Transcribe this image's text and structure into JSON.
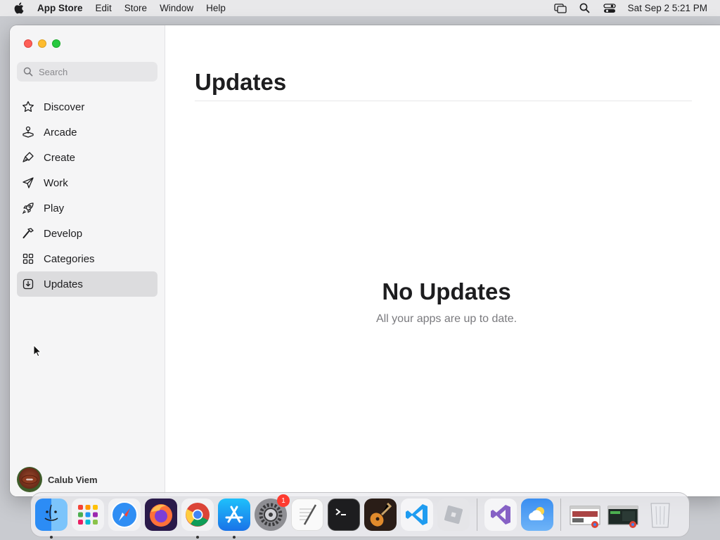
{
  "menubar": {
    "app_name": "App Store",
    "items": [
      "Edit",
      "Store",
      "Window",
      "Help"
    ],
    "clock": "Sat Sep 2  5:21 PM",
    "status_icons": [
      "screen-mirroring-icon",
      "spotlight-search-icon",
      "control-center-icon"
    ]
  },
  "sidebar": {
    "search_placeholder": "Search",
    "items": [
      {
        "label": "Discover",
        "icon": "star-icon",
        "active": false
      },
      {
        "label": "Arcade",
        "icon": "joystick-icon",
        "active": false
      },
      {
        "label": "Create",
        "icon": "brush-icon",
        "active": false
      },
      {
        "label": "Work",
        "icon": "paper-plane-icon",
        "active": false
      },
      {
        "label": "Play",
        "icon": "rocket-icon",
        "active": false
      },
      {
        "label": "Develop",
        "icon": "hammer-icon",
        "active": false
      },
      {
        "label": "Categories",
        "icon": "grid-icon",
        "active": false
      },
      {
        "label": "Updates",
        "icon": "download-icon",
        "active": true
      }
    ],
    "user_name": "Calub Viem"
  },
  "main": {
    "title": "Updates",
    "empty_title": "No Updates",
    "empty_subtitle": "All your apps are up to date."
  },
  "dock": {
    "apps": [
      {
        "name": "finder",
        "running": true
      },
      {
        "name": "launchpad",
        "running": false
      },
      {
        "name": "safari",
        "running": false
      },
      {
        "name": "firefox",
        "running": false
      },
      {
        "name": "chrome",
        "running": true
      },
      {
        "name": "app-store",
        "running": true
      },
      {
        "name": "system-settings",
        "running": false,
        "badge": "1"
      },
      {
        "name": "textedit",
        "running": false
      },
      {
        "name": "terminal",
        "running": false
      },
      {
        "name": "garageband",
        "running": false
      },
      {
        "name": "vscode",
        "running": false
      },
      {
        "name": "roblox",
        "running": false
      },
      {
        "name": "visual-studio",
        "running": false
      },
      {
        "name": "weather",
        "running": false
      },
      {
        "name": "chrome-window-1",
        "running": false
      },
      {
        "name": "chrome-window-2",
        "running": false
      },
      {
        "name": "trash",
        "running": false
      }
    ]
  },
  "colors": {
    "accent": "#0a84ff",
    "sidebar_bg": "#f5f5f6",
    "active_item_bg": "#dcdcde",
    "traffic_close": "#fe5f57",
    "traffic_minimize": "#febc2e",
    "traffic_maximize": "#28c840",
    "badge": "#fe3b30"
  }
}
